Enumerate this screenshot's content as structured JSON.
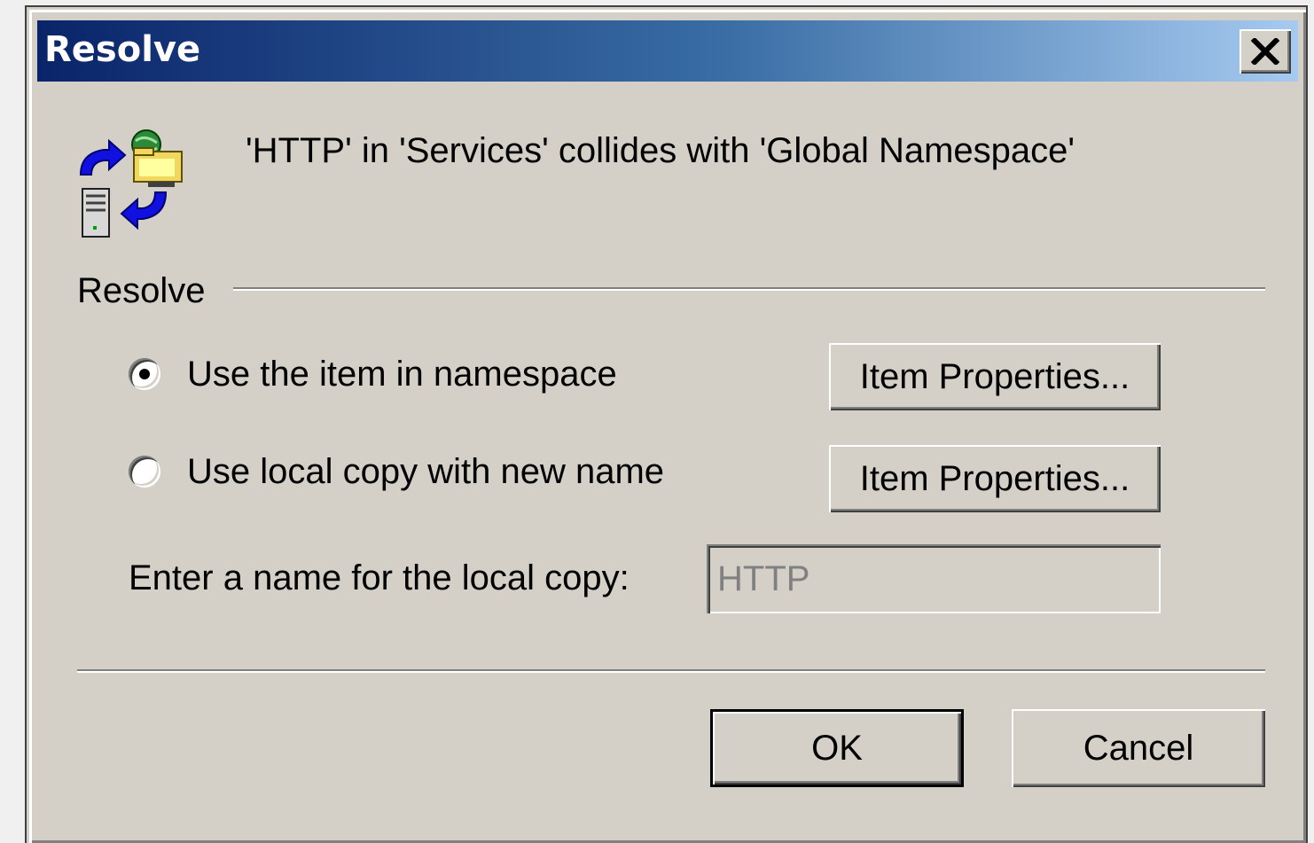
{
  "window": {
    "title": "Resolve",
    "close_glyph": "✕"
  },
  "message": "'HTTP' in 'Services' collides with 'Global Namespace'",
  "icons": {
    "app": "resolve-conflict-icon"
  },
  "group": {
    "label": "Resolve"
  },
  "options": [
    {
      "label": "Use the item in namespace",
      "selected": true
    },
    {
      "label": "Use local copy with new name",
      "selected": false
    }
  ],
  "item_properties_label": "Item Properties...",
  "local_copy": {
    "label": "Enter a name for the local copy:",
    "value": "HTTP",
    "enabled": false
  },
  "buttons": {
    "ok": "OK",
    "cancel": "Cancel"
  },
  "colors": {
    "titlebar_start": "#0a246a",
    "titlebar_end": "#a6caf0",
    "face": "#d4d0c8"
  }
}
